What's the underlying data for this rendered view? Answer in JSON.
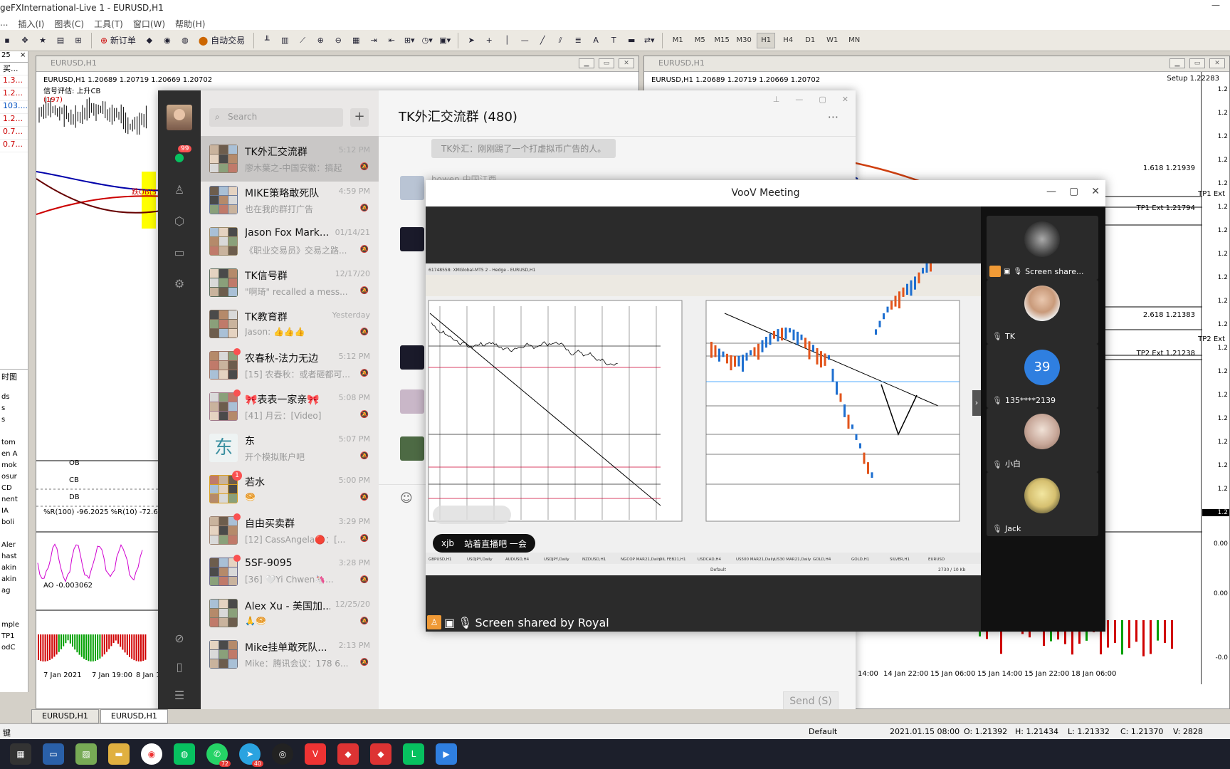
{
  "mt4": {
    "title": "geFXInternational-Live 1 - EURUSD,H1",
    "menu": [
      "插入(I)",
      "图表(C)",
      "工具(T)",
      "窗口(W)",
      "帮助(H)"
    ],
    "toolbar": {
      "new_order_label": "新订单",
      "auto_trade_label": "自动交易",
      "timeframes": [
        "M1",
        "M5",
        "M15",
        "M30",
        "H1",
        "H4",
        "D1",
        "W1",
        "MN"
      ],
      "selected_timeframe": "H1"
    },
    "market_watch": {
      "header_left": "25",
      "header_right": "买...",
      "rows": [
        "1.3...",
        "1.2...",
        "103....",
        "1.2...",
        "0.7...",
        "0.7..."
      ]
    },
    "navigator": {
      "label": "时图",
      "items": [
        "ds",
        "s",
        "s",
        "",
        "tom",
        "en A",
        "mok",
        "osur",
        "CD",
        "nent",
        "IA",
        "boli",
        "",
        "Aler",
        "hast",
        "akin",
        "akin",
        "ag",
        "",
        "",
        "mple",
        "TP1",
        "odC"
      ]
    },
    "left_chart": {
      "window_title": "EURUSD,H1",
      "header": "EURUSD,H1  1.20689 1.20719 1.20669 1.20702",
      "subheader": "信号评估: 上升CB",
      "count": "(197)",
      "annotation": "跌OB(51",
      "labels": [
        "OB",
        "CB",
        "DB"
      ],
      "wpr_header": "%R(100) -96.2025  %R(10) -72.6027",
      "ao_header": "AO -0.003062",
      "time_labels": [
        "7 Jan 2021",
        "7 Jan 19:00",
        "8 Jan 11:"
      ]
    },
    "right_chart": {
      "window_title": "EURUSD,H1",
      "header": "EURUSD,H1  1.20689 1.20719 1.20669 1.20702",
      "setup": "Setup 1.22283",
      "fib1": "1.618 1.21939",
      "tp1": "TP1 Ext",
      "tp1_ext": "TP1 Ext 1.21794",
      "fib2": "2.618 1.21383",
      "tp2": "TP2 Ext",
      "tp2_ext": "TP2 Ext 1.21238",
      "price_ticks": [
        "1.2",
        "1.2",
        "1.2",
        "1.2",
        "1.2",
        "1.2",
        "1.2",
        "1.2",
        "1.2",
        "1.2",
        "1.2",
        "1.2",
        "1.2",
        "1.2",
        "1.2",
        "1.2",
        "1.2",
        "1.2",
        "1.2"
      ],
      "current_price": "1.2",
      "ind_ticks": [
        "0.00",
        "0.00",
        "-0.0"
      ],
      "time_labels": [
        "14:00",
        "14 Jan 22:00",
        "15 Jan 06:00",
        "15 Jan 14:00",
        "15 Jan 22:00",
        "18 Jan 06:00"
      ]
    },
    "tabs": [
      "EURUSD,H1",
      "EURUSD,H1"
    ],
    "status": {
      "left": "键",
      "profile": "Default",
      "datetime": "2021.01.15 08:00",
      "open": "O: 1.21392",
      "high": "H: 1.21434",
      "low": "L: 1.21332",
      "close": "C: 1.21370",
      "volume": "V: 2828"
    }
  },
  "wechat": {
    "unread_badge": "99",
    "search_placeholder": "Search",
    "chat_title": "TK外汇交流群 (480)",
    "system_message": "TK外汇：刚刚踢了一个打虚拟币广告的人。",
    "partial_sender": "bowen  中国江西",
    "send_label": "Send (S)",
    "conversations": [
      {
        "name": "TK外汇交流群",
        "time": "5:12 PM",
        "msg": "廖木葉之-中国安徽：搞起",
        "active": true,
        "dot": false
      },
      {
        "name": "MIKE策略敢死队",
        "time": "4:59 PM",
        "msg": "也在我的群打广告",
        "dot": false
      },
      {
        "name": "Jason Fox Mark...",
        "time": "01/14/21",
        "msg": "《职业交易员》交易之路...",
        "dot": false
      },
      {
        "name": "TK信号群",
        "time": "12/17/20",
        "msg": "\"啊琦\" recalled a mess...",
        "dot": false
      },
      {
        "name": "TK教育群",
        "time": "Yesterday",
        "msg": "Jason: 👍👍👍",
        "dot": false
      },
      {
        "name": "农春秋-法力无边",
        "time": "5:12 PM",
        "msg": "[15] 农春秋：或者砸都可...",
        "dot": true
      },
      {
        "name": "🎀表表一家亲🎀",
        "time": "5:08 PM",
        "msg": "[41] 月云：[Video]",
        "dot": true
      },
      {
        "name": "东",
        "time": "5:07 PM",
        "msg": "开个模拟账户吧",
        "dot": false
      },
      {
        "name": "若水",
        "time": "5:00 PM",
        "msg": "🥯",
        "badge": "1"
      },
      {
        "name": "自由买卖群",
        "time": "3:29 PM",
        "msg": "[12] CassAngela🔴：[...",
        "dot": true
      },
      {
        "name": "5SF-9095",
        "time": "3:28 PM",
        "msg": "[36] 🤍Yi Chwen🦄...",
        "dot": true
      },
      {
        "name": "Alex Xu - 美国加...",
        "time": "12/25/20",
        "msg": "🙏🥯",
        "dot": false
      },
      {
        "name": "Mike挂单敢死队...",
        "time": "2:13 PM",
        "msg": "Mike：腾讯会议：178 6...",
        "dot": false
      }
    ]
  },
  "voov": {
    "title": "VooV Meeting",
    "share_label": "Screen shared by Royal",
    "xjb_name": "xjb",
    "xjb_msg": "站着直播吧 一会",
    "participants": [
      {
        "name": "Screen share...",
        "kind": "share"
      },
      {
        "name": "TK",
        "kind": "photo"
      },
      {
        "name": "135****2139",
        "kind": "number",
        "avatar_text": "39"
      },
      {
        "name": "小白",
        "kind": "cat"
      },
      {
        "name": "Jack",
        "kind": "wolf"
      }
    ],
    "shared_screen": {
      "title": "61748558: XMGlobal-MT5 2 - Hedge - EURUSD,H1",
      "tabs": [
        "GBPUSD,H1",
        "USDJPY,Daily",
        "AUDUSD,H4",
        "USDJPY,Daily",
        "NZDUSD,H1",
        "NGCOP MAR21,Daily",
        "OIL FEB21,H1",
        "USDCAD,H4",
        "US500 MAR21,Daily",
        "US30 MAR21,Daily",
        "GOLD,H4",
        "GOLD,H1",
        "SILVER,H1",
        "EURUSD"
      ],
      "default_label": "Default",
      "status_right": "2730 / 10 Kb"
    }
  },
  "colors": {
    "mt4_bg": "#d4d0c8",
    "wechat_sidebar": "#2e2e2e",
    "wechat_list": "#eae8e7",
    "voov_stage": "#2b2b2b",
    "accent_red": "#fa5151",
    "candle_up": "#000000",
    "ao_green": "#00a000",
    "ao_red": "#d00000"
  },
  "icons": [
    "chat-icon",
    "contacts-icon",
    "box-icon",
    "folder-icon",
    "gear-icon",
    "link-icon",
    "phone-icon",
    "menu-icon",
    "search-icon",
    "plus-icon",
    "emoji-icon",
    "mic-icon",
    "screen-share-icon"
  ]
}
